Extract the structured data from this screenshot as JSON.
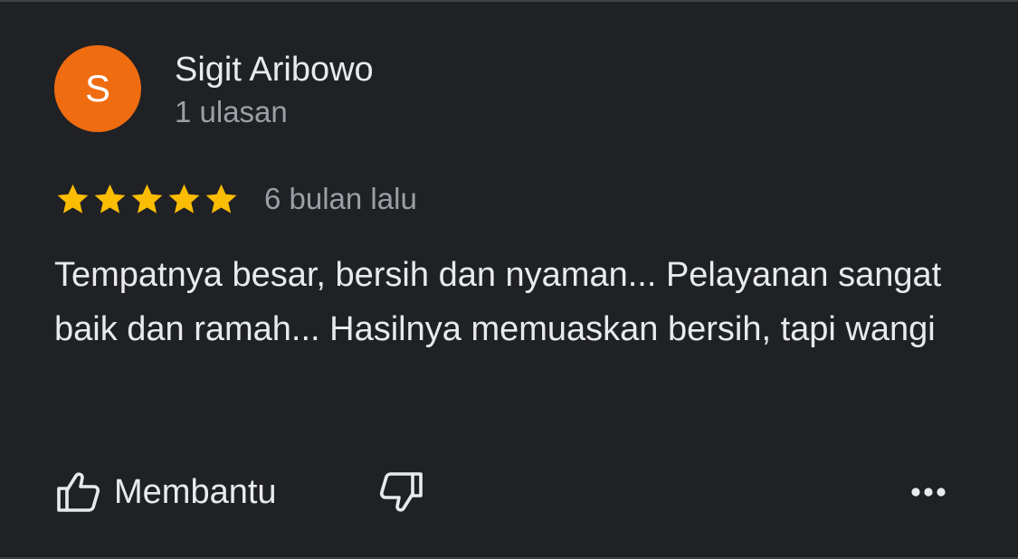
{
  "review": {
    "author": {
      "initial": "S",
      "name": "Sigit Aribowo",
      "meta": "1 ulasan",
      "avatar_color": "#f06c10"
    },
    "rating": 5,
    "rating_max": 5,
    "star_color": "#fbbc04",
    "date": "6 bulan lalu",
    "text": "Tempatnya besar, bersih dan nyaman... Pelayanan sangat baik dan ramah... Hasilnya memuaskan bersih, tapi wangi"
  },
  "actions": {
    "helpful_label": "Membantu",
    "helpful_icon": "thumbs-up-icon",
    "dislike_icon": "thumbs-down-icon",
    "more_icon": "more-horizontal-icon"
  },
  "colors": {
    "background": "#202124",
    "text_primary": "#e8eaed",
    "text_secondary": "#9aa0a6"
  }
}
